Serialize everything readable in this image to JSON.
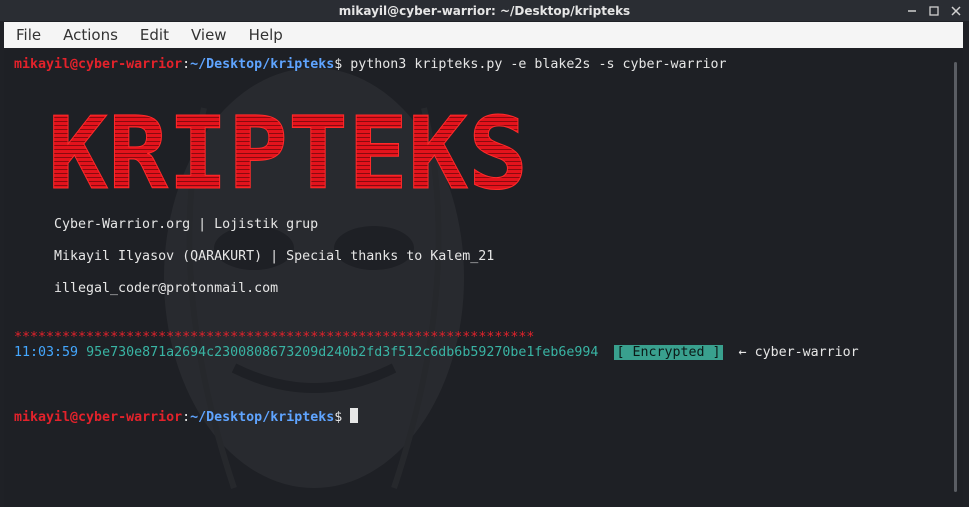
{
  "window": {
    "title": "mikayil@cyber-warrior: ~/Desktop/kripteks"
  },
  "menu": {
    "items": [
      "File",
      "Actions",
      "Edit",
      "View",
      "Help"
    ]
  },
  "terminal": {
    "prompt_user": "mikayil@cyber-warrior",
    "prompt_sep": ":",
    "prompt_path": "~/Desktop/kripteks",
    "prompt_end": "$",
    "command": " python3 kripteks.py -e blake2s -s cyber-warrior",
    "logo_text": "KRIPTEKS",
    "info_lines": [
      "Cyber-Warrior.org | Lojistik grup",
      "Mikayil Ilyasov (QARAKURT) | Special thanks to Kalem_21",
      "illegal_coder@protonmail.com"
    ],
    "separator": "*****************************************************************",
    "result_time": "11:03:59",
    "result_hash": "95e730e871a2694c2300808673209d240b2fd3f512c6db6b59270be1feb6e994",
    "result_badge": "[ Encrypted ]",
    "result_arrow": "←",
    "result_input": "cyber-warrior"
  },
  "colors": {
    "prompt_user": "#e3222b",
    "prompt_path": "#5fa4ff",
    "logo": "#e3131c",
    "time": "#44a7ff",
    "hash": "#39b4a4",
    "badge_bg": "#39a08e"
  }
}
